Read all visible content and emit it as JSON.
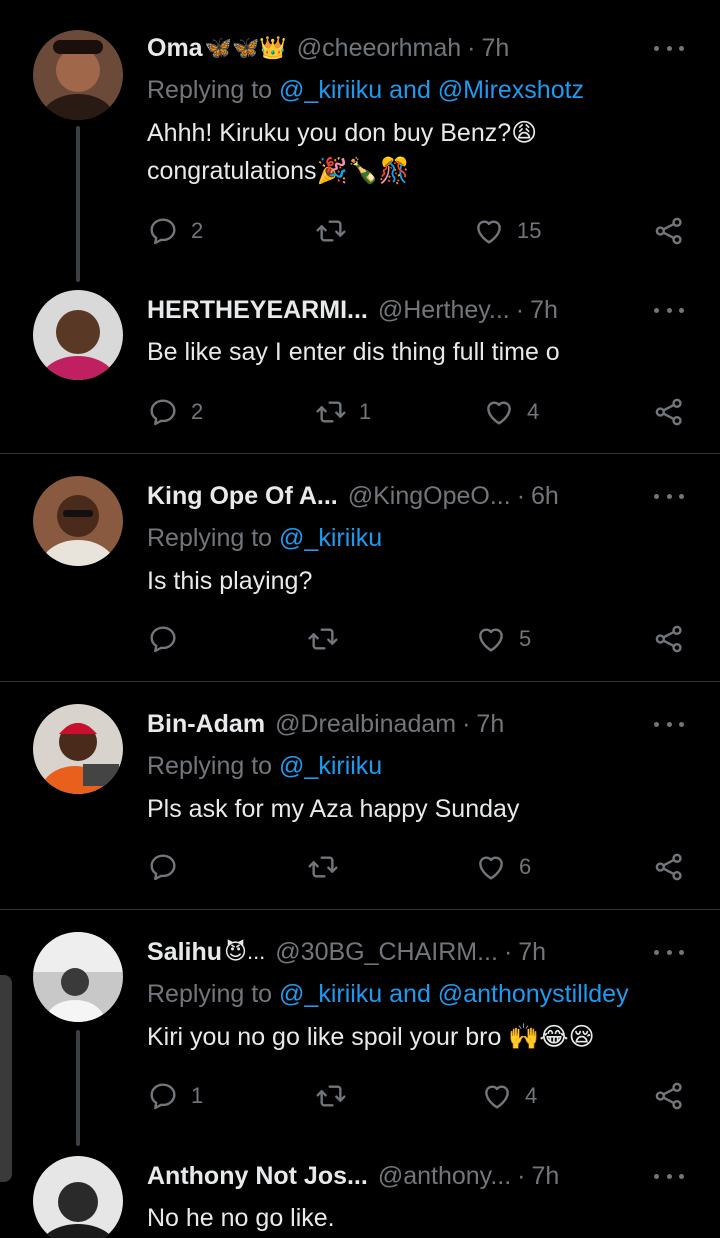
{
  "tweets": [
    {
      "name": "Oma",
      "name_emoji": "🦋🦋👑",
      "handle": "@cheeorhmah",
      "time": "7h",
      "replying_prefix": "Replying to",
      "replying_to": "@_kiriiku and @Mirexshotz",
      "text_line1": "Ahhh! Kiruku you don buy Benz?😩",
      "text_line2": " congratulations🎉🍾🎊",
      "reply_count": "2",
      "retweet_count": "",
      "like_count": "15"
    },
    {
      "name": "HERTHEYEARMI...",
      "name_emoji": "",
      "handle": "@Herthey...",
      "time": "7h",
      "replying_prefix": "",
      "replying_to": "",
      "text_line1": "Be like say I enter dis thing full time o",
      "text_line2": "",
      "reply_count": "2",
      "retweet_count": "1",
      "like_count": "4"
    },
    {
      "name": "King Ope Of A...",
      "name_emoji": "",
      "handle": "@KingOpeO...",
      "time": "6h",
      "replying_prefix": "Replying to",
      "replying_to": "@_kiriiku",
      "text_line1": "Is this playing?",
      "text_line2": "",
      "reply_count": "",
      "retweet_count": "",
      "like_count": "5"
    },
    {
      "name": "Bin-Adam",
      "name_emoji": "",
      "handle": "@Drealbinadam",
      "time": "7h",
      "replying_prefix": "Replying to",
      "replying_to": "@_kiriiku",
      "text_line1": "Pls ask for my Aza happy Sunday",
      "text_line2": "",
      "reply_count": "",
      "retweet_count": "",
      "like_count": "6"
    },
    {
      "name": "Salihu",
      "name_emoji": "😈...",
      "handle": "@30BG_CHAIRM...",
      "time": "7h",
      "replying_prefix": "Replying to",
      "replying_to": "@_kiriiku and @anthonystilldey",
      "text_line1": "Kiri you no go like spoil your bro 🙌😂😪",
      "text_line2": "",
      "reply_count": "1",
      "retweet_count": "",
      "like_count": "4"
    },
    {
      "name": "Anthony Not Jos...",
      "name_emoji": "",
      "handle": "@anthony...",
      "time": "7h",
      "replying_prefix": "",
      "replying_to": "",
      "text_line1": "No he no go like.",
      "text_line2": "",
      "reply_count": "",
      "retweet_count": "",
      "like_count": ""
    }
  ],
  "icons": {
    "reply": "reply-icon",
    "retweet": "retweet-icon",
    "like": "heart-icon",
    "share": "share-icon",
    "more": "more-options-icon"
  },
  "colors": {
    "background": "#000000",
    "text": "#e7e9ea",
    "muted": "#71767b",
    "link": "#1d9bf0",
    "divider": "#2f3336"
  }
}
